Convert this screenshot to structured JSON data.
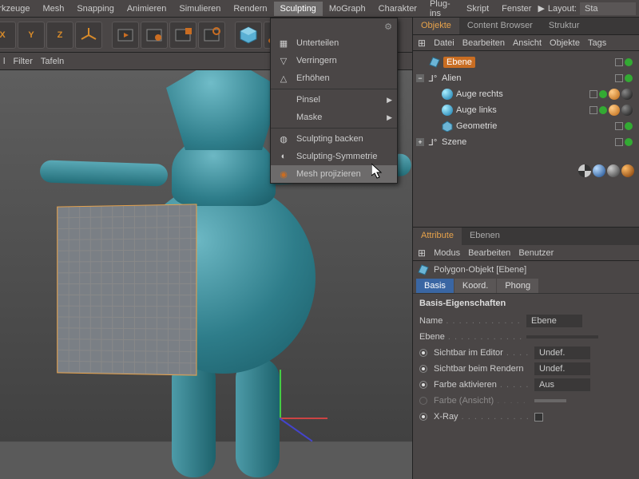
{
  "menu": {
    "items": [
      "Werkzeuge",
      "Mesh",
      "Snapping",
      "Animieren",
      "Simulieren",
      "Rendern",
      "Sculpting",
      "MoGraph",
      "Charakter",
      "Plug-ins",
      "Skript",
      "Fenster"
    ],
    "active_index": 6,
    "layout_label": "Layout:",
    "layout_value": "Sta"
  },
  "subbar": [
    "l",
    "Filter",
    "Tafeln"
  ],
  "axis_buttons": [
    "X",
    "Y",
    "Z"
  ],
  "dropdown": {
    "items": [
      {
        "label": "Unterteilen",
        "icon": "grid"
      },
      {
        "label": "Verringern",
        "icon": "minus"
      },
      {
        "label": "Erhöhen",
        "icon": "plus"
      }
    ],
    "groups": [
      {
        "label": "Pinsel",
        "submenu": true
      },
      {
        "label": "Maske",
        "submenu": true
      }
    ],
    "group2": [
      {
        "label": "Sculpting backen",
        "icon": "bake"
      },
      {
        "label": "Sculpting-Symmetrie",
        "icon": "sym"
      },
      {
        "label": "Mesh projizieren",
        "icon": "proj",
        "highlight": true
      }
    ],
    "gear_title": ""
  },
  "right": {
    "tabs": [
      "Objekte",
      "Content Browser",
      "Struktur"
    ],
    "active_tab_index": 0,
    "submenu": [
      "Datei",
      "Bearbeiten",
      "Ansicht",
      "Objekte",
      "Tags"
    ],
    "tree": [
      {
        "depth": 0,
        "icon": "plane",
        "label": "Ebene",
        "selected": true,
        "expander": null
      },
      {
        "depth": 0,
        "icon": "null",
        "label": "Alien",
        "expander": "-"
      },
      {
        "depth": 1,
        "icon": "sphere",
        "label": "Auge rechts"
      },
      {
        "depth": 1,
        "icon": "sphere",
        "label": "Auge links"
      },
      {
        "depth": 1,
        "icon": "geom",
        "label": "Geometrie"
      },
      {
        "depth": 0,
        "icon": "null",
        "label": "Szene",
        "expander": "+"
      }
    ]
  },
  "attr": {
    "tabs": [
      "Attribute",
      "Ebenen"
    ],
    "active_tab_index": 0,
    "submenu": [
      "Modus",
      "Bearbeiten",
      "Benutzer"
    ],
    "header": "Polygon-Objekt [Ebene]",
    "subtabs": [
      "Basis",
      "Koord.",
      "Phong"
    ],
    "active_subtab_index": 0,
    "group": "Basis-Eigenschaften",
    "props": [
      {
        "label": "Name",
        "value": "Ebene",
        "type": "text"
      },
      {
        "label": "Ebene",
        "value": "",
        "type": "text"
      },
      {
        "label": "Sichtbar im Editor",
        "value": "Undef.",
        "type": "radio",
        "on": true
      },
      {
        "label": "Sichtbar beim Rendern",
        "value": "Undef.",
        "type": "radio",
        "on": true
      },
      {
        "label": "Farbe aktivieren",
        "value": "Aus",
        "type": "radio",
        "on": true
      },
      {
        "label": "Farbe (Ansicht)",
        "value": "",
        "type": "color",
        "dim": true
      },
      {
        "label": "X-Ray",
        "value": "",
        "type": "check",
        "on": true
      }
    ]
  }
}
